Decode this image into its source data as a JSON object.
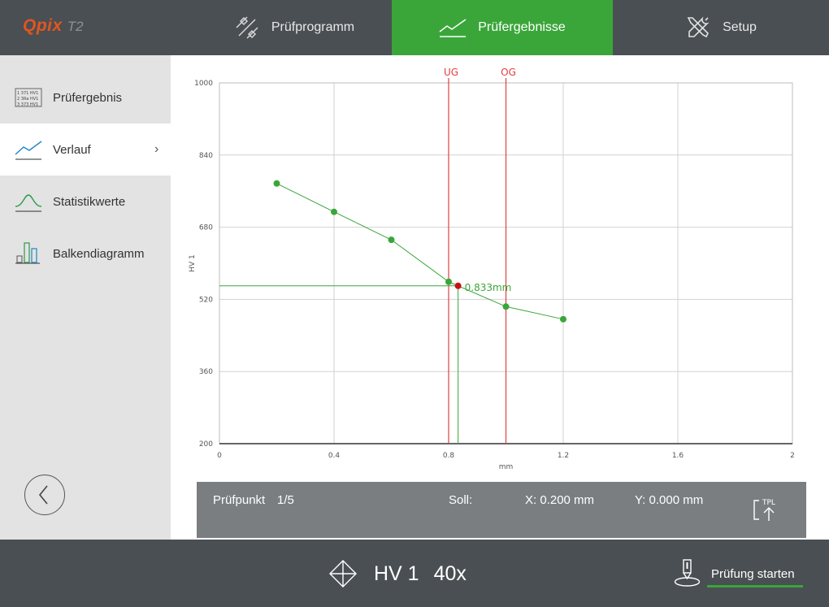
{
  "logo": {
    "brand": "Qpix",
    "suffix": "T2"
  },
  "nav": {
    "tabs": [
      {
        "label": "Prüfprogramm",
        "icon": "program-icon"
      },
      {
        "label": "Prüfergebnisse",
        "icon": "results-chart-icon",
        "active": true
      },
      {
        "label": "Setup",
        "icon": "tools-icon"
      }
    ]
  },
  "sidebar": {
    "items": [
      {
        "label": "Prüfergebnis",
        "icon": "result-table-icon"
      },
      {
        "label": "Verlauf",
        "icon": "trend-line-icon",
        "active": true,
        "chevron": "›"
      },
      {
        "label": "Statistikwerte",
        "icon": "bell-curve-icon"
      },
      {
        "label": "Balkendiagramm",
        "icon": "bar-chart-icon"
      }
    ],
    "result_icon_rows": [
      "1  371  HV1",
      "2  3Ra  HV1",
      "3  373  HV1"
    ]
  },
  "chart_data": {
    "type": "line",
    "xlabel": "mm",
    "ylabel": "HV 1",
    "xlim": [
      0,
      2
    ],
    "ylim": [
      200,
      1000
    ],
    "x_ticks": [
      "0",
      "0.4",
      "0.8",
      "1.2",
      "1.6",
      "2"
    ],
    "y_ticks": [
      "200",
      "360",
      "520",
      "680",
      "840",
      "1000"
    ],
    "grid": true,
    "series": [
      {
        "x": [
          0.2,
          0.4,
          0.6,
          0.8,
          1.0,
          1.2
        ],
        "y": [
          777,
          714,
          652,
          559,
          504,
          476
        ],
        "color": "#3aa63a"
      }
    ],
    "limits": [
      {
        "label": "UG",
        "x": 0.8,
        "color": "#e04040"
      },
      {
        "label": "OG",
        "x": 1.0,
        "color": "#e04040"
      }
    ],
    "marker": {
      "x": 0.833,
      "y": 550,
      "label": "0.833mm",
      "color": "#cc1111"
    }
  },
  "infobar": {
    "point_label": "Prüfpunkt",
    "point_value": "1/5",
    "soll_label": "Soll:",
    "x_value": "X: 0.200 mm",
    "y_value": "Y: 0.000 mm",
    "tpl_label": "TPL"
  },
  "bottom": {
    "method": "HV 1",
    "magnification": "40x",
    "start_label": "Prüfung starten"
  },
  "colors": {
    "accent": "#3aa63a",
    "bar": "#4a4f53",
    "limit": "#e04040",
    "logo": "#e2561f"
  }
}
